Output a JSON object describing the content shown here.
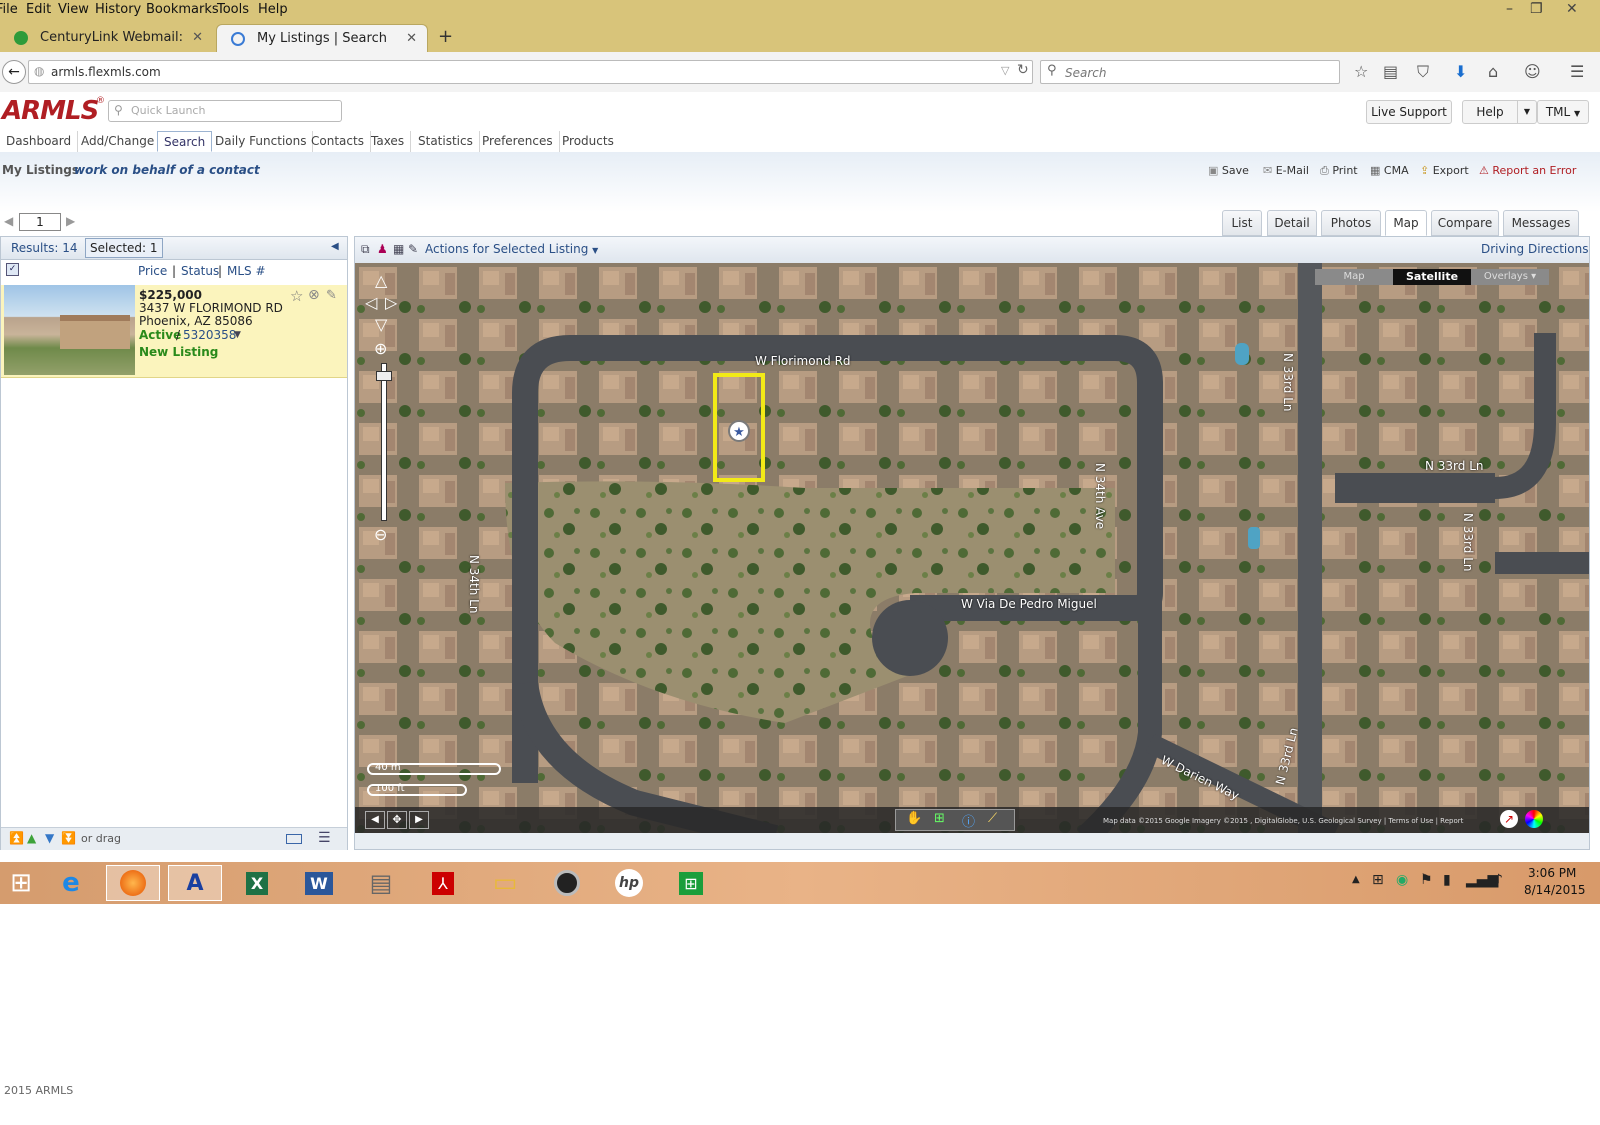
{
  "browser": {
    "menu": [
      "File",
      "Edit",
      "View",
      "History",
      "Bookmarks",
      "Tools",
      "Help"
    ],
    "tabs": [
      {
        "label": "CenturyLink Webmail: Inbox"
      },
      {
        "label": "My Listings | Search Result..."
      }
    ],
    "url": "armls.flexmls.com",
    "search_placeholder": "Search"
  },
  "app": {
    "logo": "ARMLS",
    "quick_launch_placeholder": "Quick Launch",
    "header_buttons": {
      "live_support": "Live Support",
      "help": "Help",
      "user": "TML"
    },
    "nav_tabs": [
      "Dashboard",
      "Add/Change",
      "Search",
      "Daily Functions",
      "Contacts",
      "Taxes",
      "Statistics",
      "Preferences",
      "Products"
    ],
    "active_tab": "Search",
    "page_title": "My Listings",
    "behalf_link": "work on behalf of a contact",
    "actions": {
      "save": "Save",
      "email": "E-Mail",
      "print": "Print",
      "cma": "CMA",
      "export": "Export",
      "report": "Report an Error"
    },
    "page_number": "1",
    "view_tabs": [
      "List",
      "Detail",
      "Photos",
      "Map",
      "Compare",
      "Messages"
    ],
    "active_view": "Map"
  },
  "results": {
    "count_label": "Results: 14",
    "selected_label": "Selected: 1",
    "sort": {
      "price": "Price",
      "sep": "|",
      "status": "Status",
      "mls": "MLS #"
    },
    "listing": {
      "price": "$225,000",
      "address1": "3437 W FLORIMOND RD",
      "address2": "Phoenix, AZ 85086",
      "status": "Active",
      "slash": "/",
      "mls": "5320358",
      "tag": "New Listing"
    },
    "footer_drag": "or drag"
  },
  "map": {
    "actions_label": "Actions for Selected Listing",
    "driving_directions": "Driving Directions",
    "type_buttons": {
      "map": "Map",
      "satellite": "Satellite",
      "overlays": "Overlays ▾"
    },
    "streets": {
      "florimond": "W Florimond Rd",
      "n34th_ave": "N 34th Ave",
      "n34th_ln": "N 34th Ln",
      "via_de_pedro": "W Via De Pedro Miguel",
      "n33rd_ln_a": "N 33rd Ln",
      "n33rd_ln_b": "N 33rd Ln",
      "n33rd_ln_c": "N 33rd Ln",
      "n33rd_ln_d": "N 33rd Ln",
      "darien": "W Darien Way"
    },
    "scale": {
      "metric": "40 m",
      "imperial": "100 ft"
    },
    "attribution": "Map data ©2015 Google Imagery ©2015 , DigitalGlobe, U.S. Geological Survey | Terms of Use | Report"
  },
  "taskbar": {
    "time": "3:06 PM",
    "date": "8/14/2015"
  },
  "footer": {
    "copyright": "2015 ARMLS"
  },
  "colors": {
    "menubar": "#d8c47a",
    "highlight": "#fbf4bd",
    "active_green": "#2a8a1b",
    "link_blue": "#2a4f86",
    "logo_red": "#b01e23",
    "selection_yellow": "#f2ea17"
  }
}
